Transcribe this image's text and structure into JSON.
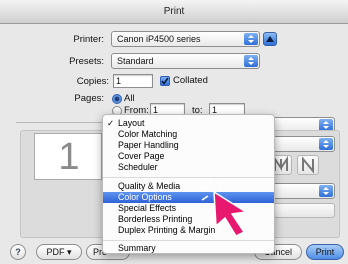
{
  "window": {
    "title": "Print"
  },
  "printer": {
    "label": "Printer:",
    "value": "Canon iP4500 series"
  },
  "presets": {
    "label": "Presets:",
    "value": "Standard"
  },
  "copies": {
    "label": "Copies:",
    "value": "1",
    "collated_label": "Collated",
    "collated_checked": true
  },
  "pages": {
    "label": "Pages:",
    "all_label": "All",
    "from_label": "From:",
    "from_value": "1",
    "to_label": "to:",
    "to_value": "1",
    "selected": "All"
  },
  "preview": {
    "page_number": "1"
  },
  "menu": {
    "items": [
      {
        "label": "Layout",
        "checked": true,
        "selected": false
      },
      {
        "label": "Color Matching",
        "checked": false,
        "selected": false
      },
      {
        "label": "Paper Handling",
        "checked": false,
        "selected": false
      },
      {
        "label": "Cover Page",
        "checked": false,
        "selected": false
      },
      {
        "label": "Scheduler",
        "checked": false,
        "selected": false
      },
      {
        "label": "Quality & Media",
        "checked": false,
        "selected": false
      },
      {
        "label": "Color Options",
        "checked": false,
        "selected": true
      },
      {
        "label": "Special Effects",
        "checked": false,
        "selected": false
      },
      {
        "label": "Borderless Printing",
        "checked": false,
        "selected": false
      },
      {
        "label": "Duplex Printing & Margin",
        "checked": false,
        "selected": false
      },
      {
        "label": "Summary",
        "checked": false,
        "selected": false
      }
    ]
  },
  "footer": {
    "help_label": "?",
    "pdf_label": "PDF ▾",
    "preview_label": "Pre",
    "cancel_label": "Cancel",
    "print_label": "Print"
  },
  "colors": {
    "accent": "#2f6fd8",
    "cursor": "#e8186f",
    "selection": "#3b6fe0"
  }
}
